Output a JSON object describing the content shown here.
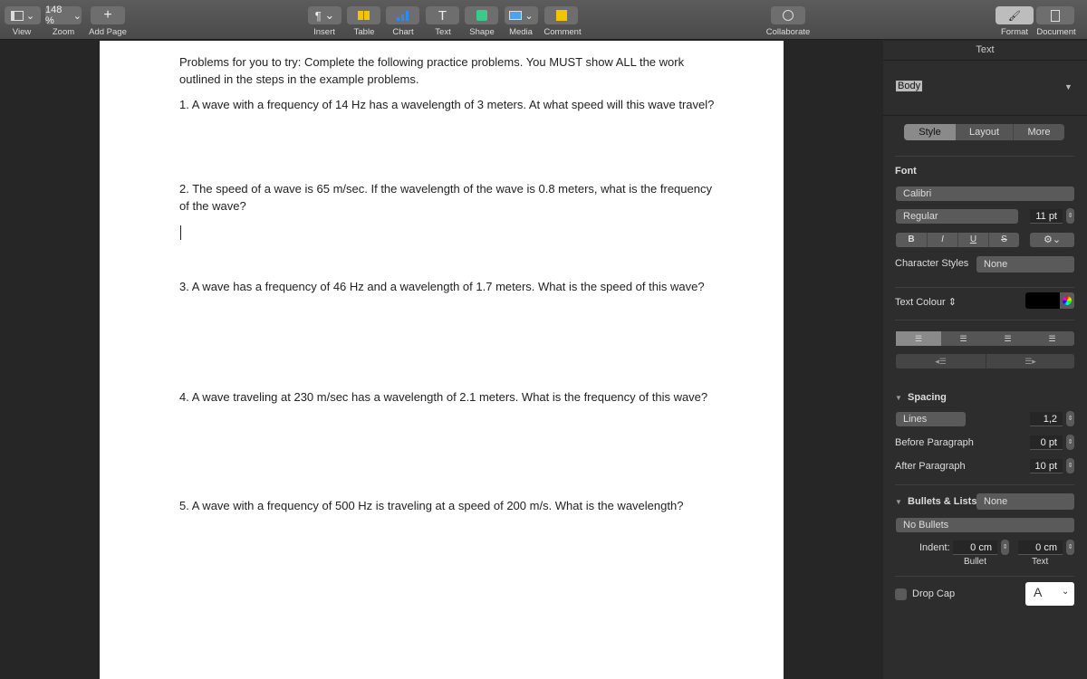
{
  "toolbar": {
    "zoom_value": "148 %",
    "labels": {
      "view": "View",
      "zoom": "Zoom",
      "add_page": "Add Page",
      "insert": "Insert",
      "table": "Table",
      "chart": "Chart",
      "text": "Text",
      "shape": "Shape",
      "media": "Media",
      "comment": "Comment",
      "collaborate": "Collaborate",
      "format": "Format",
      "document": "Document"
    },
    "insert_glyph": "¶",
    "text_glyph": "T",
    "add_glyph": "+"
  },
  "document": {
    "intro": "Problems for you to try: Complete the following practice problems. You MUST show ALL the work outlined in the steps in the example problems.",
    "problems": [
      "1. A wave with a frequency of 14 Hz has a wavelength of 3 meters. At what speed will this wave travel?",
      "2. The speed of a wave is 65 m/sec. If the wavelength of the wave is 0.8 meters, what is the frequency of the wave?",
      "3. A wave has a frequency of 46 Hz and a wavelength of 1.7 meters. What is the speed of this wave?",
      "4. A wave traveling at 230 m/sec has a wavelength of 2.1 meters. What is the frequency of this wave?",
      "5. A wave with a frequency of 500 Hz is traveling at a speed of 200 m/s. What is the wavelength?"
    ]
  },
  "sidebar": {
    "header": "Text",
    "paragraph_style": "Body",
    "tabs": [
      "Style",
      "Layout",
      "More"
    ],
    "font_label": "Font",
    "font_family": "Calibri",
    "font_weight": "Regular",
    "font_size": "11 pt",
    "format_buttons": [
      "B",
      "I",
      "U",
      "S"
    ],
    "character_styles_label": "Character Styles",
    "character_styles_value": "None",
    "text_colour_label": "Text Colour",
    "text_colour": "#000000",
    "spacing_label": "Spacing",
    "spacing_mode": "Lines",
    "spacing_value": "1,2",
    "before_paragraph_label": "Before Paragraph",
    "before_paragraph_value": "0 pt",
    "after_paragraph_label": "After Paragraph",
    "after_paragraph_value": "10 pt",
    "bullets_label": "Bullets & Lists",
    "bullets_value": "None",
    "bullets_style": "No Bullets",
    "indent_label": "Indent:",
    "indent_bullet": "0 cm",
    "indent_text": "0 cm",
    "indent_bullet_label": "Bullet",
    "indent_text_label": "Text",
    "drop_cap_label": "Drop Cap",
    "drop_cap_checked": false,
    "drop_cap_glyph": "A"
  }
}
